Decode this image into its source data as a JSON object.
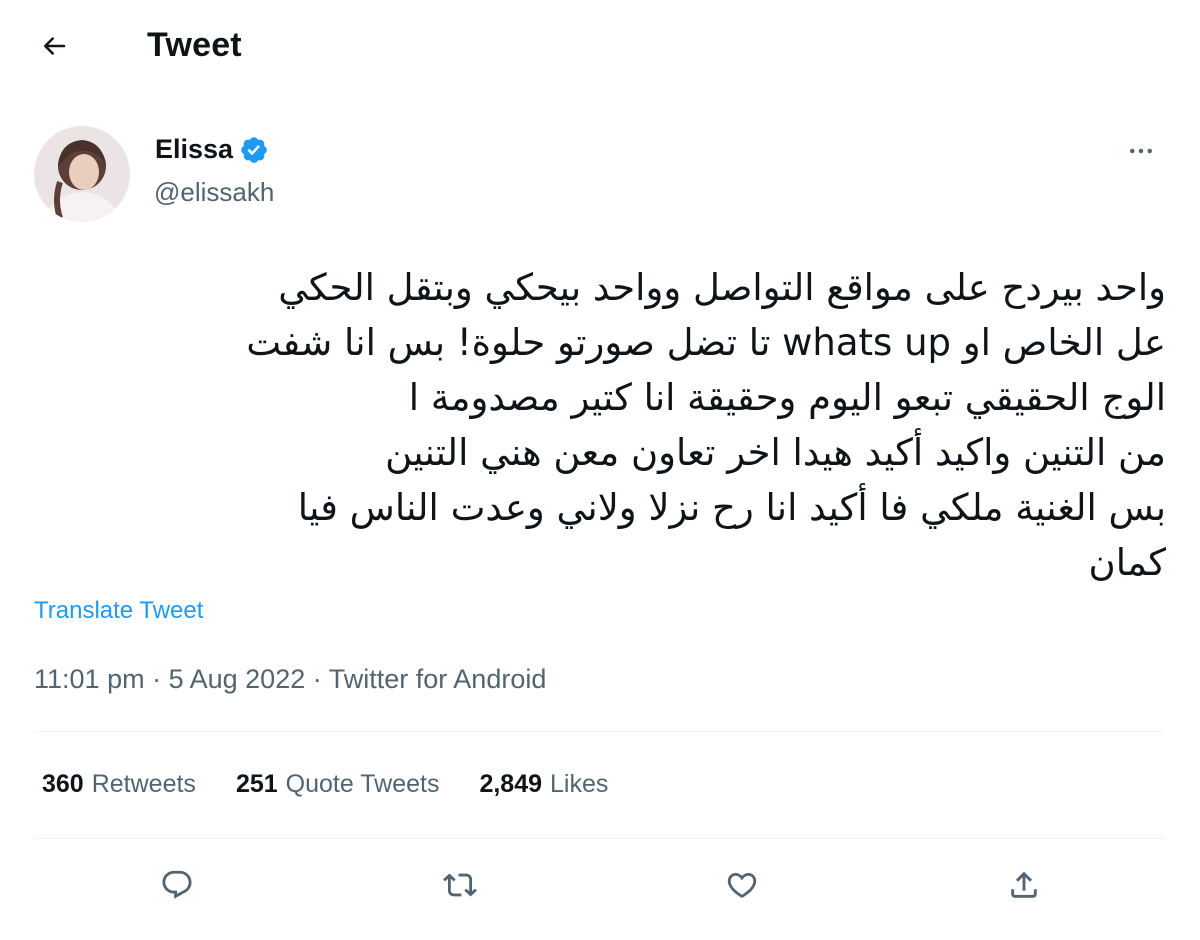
{
  "header": {
    "title": "Tweet",
    "back_icon": "arrow-left-icon"
  },
  "author": {
    "name": "Elissa",
    "handle": "@elissakh",
    "verified": true,
    "verified_color": "#1d9bf0"
  },
  "tweet": {
    "lines": [
      "واحد بيردح  على مواقع التواصل وواحد بيحكي  وبتقل الحكي",
      "عل الخاص او whats up تا تضل صورتو حلوة! بس انا شفت",
      "الوج الحقيقي تبعو اليوم وحقيقة انا كتير  مصدومة ا",
      "من التنين واكيد أكيد هيدا اخر تعاون معن هني التنين",
      "بس الغنية ملكي فا أكيد انا رح نزلا ولاني وعدت الناس فيا",
      "كمان"
    ],
    "translate_label": "Translate Tweet",
    "time": "11:01 pm",
    "date": "5 Aug 2022",
    "source": "Twitter for Android",
    "separator": "·"
  },
  "stats": [
    {
      "value": "360",
      "label": "Retweets"
    },
    {
      "value": "251",
      "label": "Quote Tweets"
    },
    {
      "value": "2,849",
      "label": "Likes"
    }
  ],
  "actions": [
    "reply-icon",
    "retweet-icon",
    "like-icon",
    "share-icon"
  ],
  "colors": {
    "accent": "#1d9bf0",
    "text_primary": "#0f1419",
    "text_secondary": "#536471",
    "divider": "#eff3f4"
  }
}
